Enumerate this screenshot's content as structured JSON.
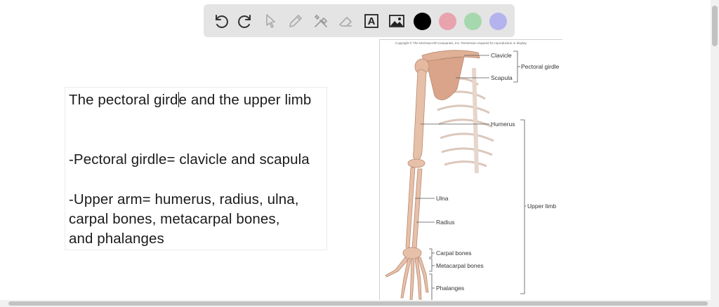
{
  "toolbar": {
    "tools": [
      "undo-icon",
      "redo-icon",
      "select-pointer-icon",
      "pen-icon",
      "tools-icon",
      "eraser-icon",
      "text-tool-icon",
      "image-icon"
    ],
    "text_tool_glyph": "A",
    "colors": {
      "black": "#000000",
      "pink": "#e8a3ad",
      "green": "#a6d8ad",
      "lavender": "#b4b3ee"
    },
    "background": "#e4e4e4"
  },
  "notes": {
    "line1_before_caret": "The pectoral gird",
    "line1_after_caret": "e and the upper limb",
    "line2": "-Pectoral girdle= clavicle and scapula",
    "line3": "-Upper arm= humerus, radius, ulna,",
    "line4": "carpal bones, metacarpal bones,",
    "line5": "and phalanges"
  },
  "figure": {
    "copyright": "Copyright © The McGraw-Hill Companies, Inc. Permission required for reproduction or display.",
    "labels": {
      "clavicle": "Clavicle",
      "scapula": "Scapula",
      "pectoral_girdle": "Pectoral girdle",
      "humerus": "Humerus",
      "ulna": "Ulna",
      "radius": "Radius",
      "upper_limb": "Upper limb",
      "carpal": "Carpal bones",
      "metacarpal": "Metacarpal bones",
      "phalanges": "Phalanges"
    },
    "bone_color": "#e3b79f"
  }
}
